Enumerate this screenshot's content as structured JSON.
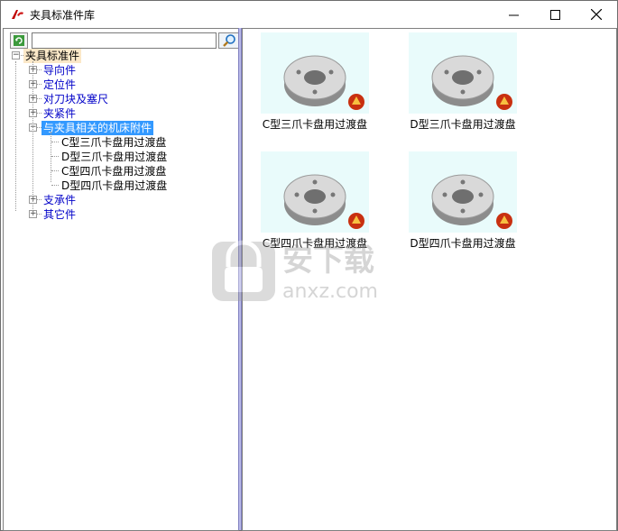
{
  "window": {
    "title": "夹具标准件库",
    "controls": {
      "minimize": "minimize-icon",
      "maximize": "maximize-icon",
      "close": "close-icon"
    }
  },
  "search": {
    "value": "",
    "placeholder": ""
  },
  "tree": {
    "root": "夹具标准件",
    "items": [
      {
        "label": "导向件",
        "expanded": false
      },
      {
        "label": "定位件",
        "expanded": false
      },
      {
        "label": "对刀块及塞尺",
        "expanded": false
      },
      {
        "label": "夹紧件",
        "expanded": false
      },
      {
        "label": "与夹具相关的机床附件",
        "expanded": true,
        "selected": true,
        "children": [
          "C型三爪卡盘用过渡盘",
          "D型三爪卡盘用过渡盘",
          "C型四爪卡盘用过渡盘",
          "D型四爪卡盘用过渡盘"
        ]
      },
      {
        "label": "支承件",
        "expanded": false
      },
      {
        "label": "其它件",
        "expanded": false
      }
    ]
  },
  "gallery": [
    {
      "caption": "C型三爪卡盘用过渡盘"
    },
    {
      "caption": "D型三爪卡盘用过渡盘"
    },
    {
      "caption": "C型四爪卡盘用过渡盘"
    },
    {
      "caption": "D型四爪卡盘用过渡盘"
    }
  ],
  "watermark": {
    "site": "安下载",
    "domain": "anxz.com"
  },
  "colors": {
    "selection": "#3399ff",
    "root_highlight": "#fbe8c8",
    "tree_text": "#0000c8",
    "splitter": "#b9b9e9",
    "thumb_bg": "#e9fbfb"
  }
}
